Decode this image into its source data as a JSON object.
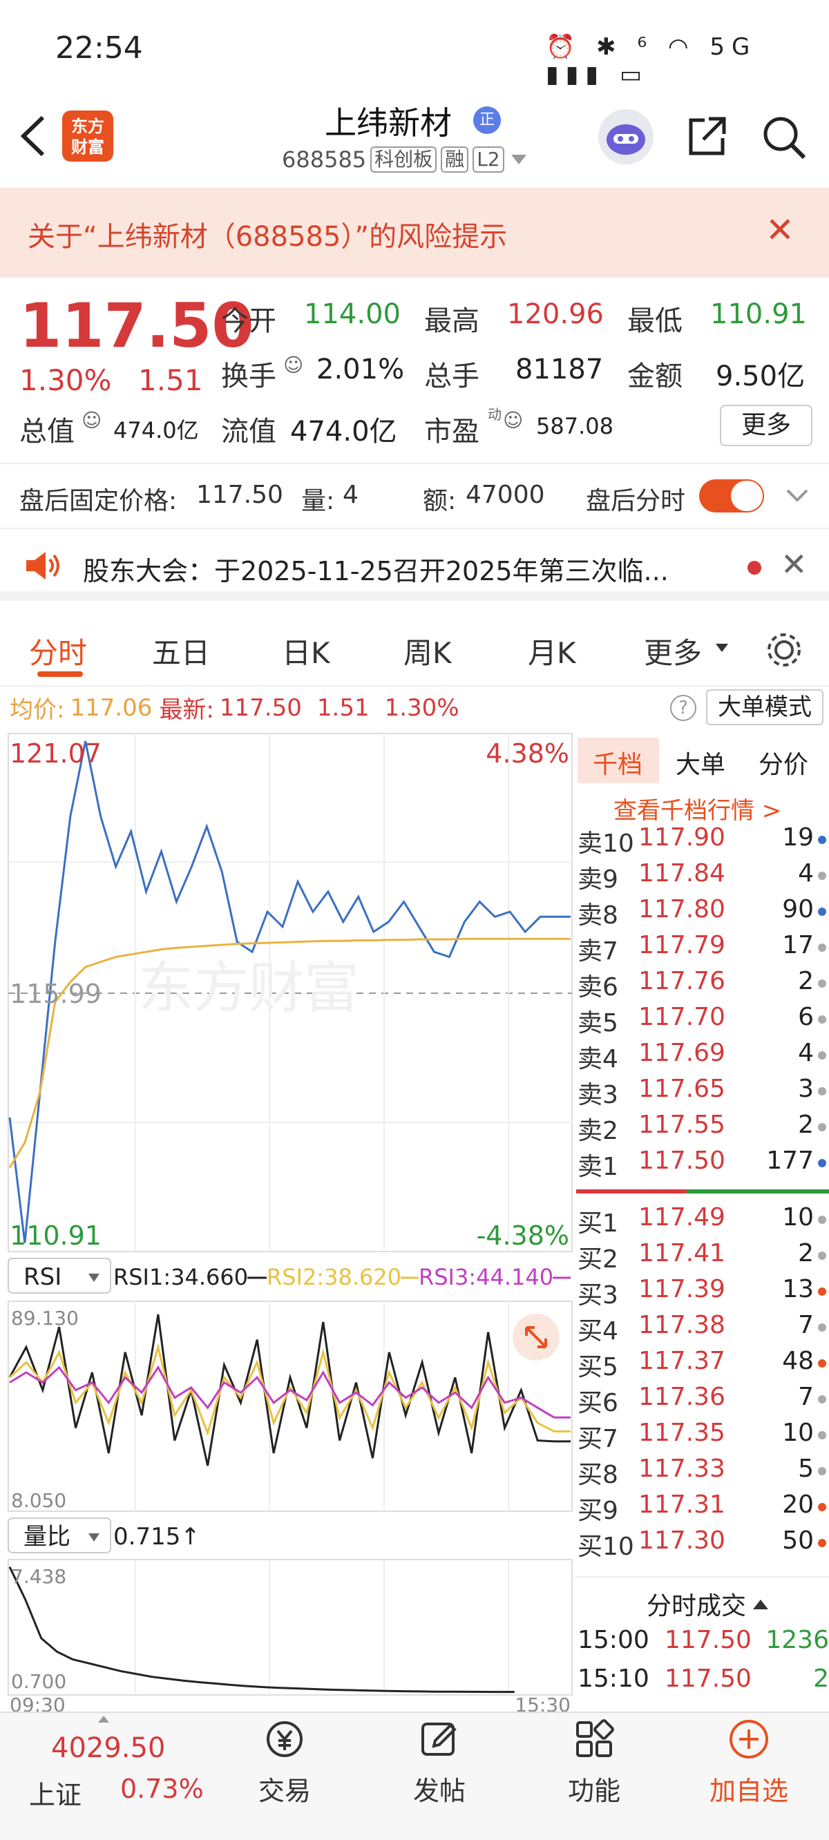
{
  "status_bar": {
    "time": "22:54",
    "icons": "⏰ ✱ ⁶ ◠ 5G ▮▮▮ ▭"
  },
  "header": {
    "logo_line1": "东方",
    "logo_line2": "财富",
    "stock_name": "上纬新材",
    "name_badge": "正",
    "stock_code": "688585",
    "tags": [
      "科创板",
      "融",
      "L2"
    ]
  },
  "risk_banner": {
    "text": "关于“上纬新材（688585）”的风险提示"
  },
  "quote": {
    "price": "117.50",
    "change_pct": "1.30%",
    "change_val": "1.51",
    "open_label": "今开",
    "open": "114.00",
    "high_label": "最高",
    "high": "120.96",
    "low_label": "最低",
    "low": "110.91",
    "turnover_label": "换手",
    "turnover": "2.01%",
    "volume_label": "总手",
    "volume": "81187",
    "amount_label": "金额",
    "amount": "9.50亿",
    "mktcap_label": "总值",
    "mktcap": "474.0亿",
    "float_label": "流值",
    "float": "474.0亿",
    "pe_label": "市盈",
    "pe_sup": "动",
    "pe": "587.08",
    "more": "更多"
  },
  "after_hours": {
    "price_label": "盘后固定价格:",
    "price": "117.50",
    "vol_label": "量:",
    "vol": "4",
    "amt_label": "额:",
    "amt": "47000",
    "timeshare_label": "盘后分时",
    "toggle_on": true
  },
  "notice": {
    "text": "股东大会：于2025-11-25召开2025年第三次临..."
  },
  "tabs": [
    "分时",
    "五日",
    "日K",
    "周K",
    "月K",
    "更多"
  ],
  "avg_row": {
    "avg_label": "均价:",
    "avg": "117.06",
    "latest_label": "最新:",
    "latest": "117.50",
    "chg": "1.51",
    "pct": "1.30%",
    "big_order_mode": "大单模式"
  },
  "chart_data": [
    {
      "type": "line",
      "title": "分时",
      "y_top_label": "121.07",
      "y_mid_label": "115.99",
      "y_bottom_label": "110.91",
      "pct_top_label": "4.38%",
      "pct_bottom_label": "-4.38%",
      "watermark": "东方财富",
      "ylim": [
        110.91,
        121.07
      ],
      "series": [
        {
          "name": "price",
          "color": "#3a6fc4",
          "values": [
            113.5,
            111.0,
            114.0,
            117.0,
            119.5,
            121.0,
            119.5,
            118.5,
            119.2,
            118.0,
            118.8,
            117.8,
            118.5,
            119.3,
            118.4,
            117.0,
            116.8,
            117.6,
            117.3,
            118.2,
            117.6,
            118.0,
            117.4,
            117.9,
            117.2,
            117.4,
            117.8,
            117.3,
            116.8,
            116.7,
            117.4,
            117.8,
            117.5,
            117.6,
            117.2,
            117.5,
            117.5,
            117.5
          ]
        },
        {
          "name": "avg",
          "color": "#e9b23f",
          "values": [
            112.5,
            113.0,
            114.0,
            115.8,
            116.2,
            116.5,
            116.6,
            116.7,
            116.75,
            116.8,
            116.85,
            116.88,
            116.9,
            116.92,
            116.94,
            116.96,
            116.97,
            116.98,
            116.99,
            117.0,
            117.01,
            117.02,
            117.02,
            117.03,
            117.03,
            117.04,
            117.04,
            117.05,
            117.05,
            117.05,
            117.06,
            117.06,
            117.06,
            117.06,
            117.06,
            117.06,
            117.06,
            117.06
          ]
        }
      ]
    },
    {
      "type": "line",
      "title": "RSI",
      "ylim": [
        8.05,
        89.13
      ],
      "y_top_label": "89.130",
      "y_bottom_label": "8.050",
      "series": [
        {
          "name": "RSI1",
          "label": "RSI1:34.660",
          "color": "#222222",
          "values": [
            60,
            72,
            55,
            80,
            40,
            62,
            30,
            70,
            45,
            85,
            35,
            55,
            25,
            65,
            50,
            75,
            30,
            60,
            40,
            82,
            35,
            58,
            28,
            70,
            45,
            66,
            38,
            60,
            30,
            78,
            40,
            55,
            35,
            34.66,
            34.66
          ]
        },
        {
          "name": "RSI2",
          "label": "RSI2:38.620",
          "color": "#e9c23f",
          "values": [
            60,
            66,
            58,
            70,
            50,
            58,
            42,
            62,
            50,
            72,
            45,
            55,
            38,
            60,
            52,
            66,
            42,
            56,
            46,
            70,
            44,
            55,
            40,
            62,
            48,
            58,
            44,
            56,
            40,
            66,
            46,
            52,
            42,
            38.62,
            38.62
          ]
        },
        {
          "name": "RSI3",
          "label": "RSI3:44.140",
          "color": "#c040c0",
          "values": [
            58,
            62,
            58,
            64,
            55,
            58,
            50,
            60,
            54,
            64,
            52,
            56,
            48,
            58,
            54,
            60,
            50,
            55,
            51,
            62,
            50,
            54,
            49,
            58,
            52,
            56,
            50,
            54,
            48,
            60,
            50,
            52,
            48,
            44.14,
            44.14
          ]
        }
      ]
    },
    {
      "type": "line",
      "title": "量比",
      "indicator_value": "0.715↑",
      "ylim": [
        0.7,
        7.438
      ],
      "y_top_label": "7.438",
      "y_bottom_label": "0.700",
      "x_start_label": "09:30",
      "x_end_label": "15:30",
      "series": [
        {
          "name": "量比",
          "color": "#222222",
          "values": [
            7.2,
            5.5,
            3.5,
            2.8,
            2.4,
            2.2,
            2.0,
            1.8,
            1.65,
            1.5,
            1.4,
            1.3,
            1.22,
            1.15,
            1.08,
            1.02,
            0.97,
            0.93,
            0.9,
            0.87,
            0.84,
            0.82,
            0.8,
            0.78,
            0.76,
            0.75,
            0.74,
            0.73,
            0.725,
            0.72,
            0.718,
            0.716,
            0.715
          ]
        }
      ]
    }
  ],
  "indicators": {
    "rsi_select": "RSI",
    "vr_select": "量比"
  },
  "order_book": {
    "tabs": [
      "千档",
      "大单",
      "分价"
    ],
    "view_link": "查看千档行情 >",
    "asks": [
      {
        "label": "卖10",
        "price": "117.90",
        "vol": "19",
        "dot": "#3a6fc4"
      },
      {
        "label": "卖9",
        "price": "117.84",
        "vol": "4",
        "dot": "#aaaaaa"
      },
      {
        "label": "卖8",
        "price": "117.80",
        "vol": "90",
        "dot": "#3a6fc4"
      },
      {
        "label": "卖7",
        "price": "117.79",
        "vol": "17",
        "dot": "#aaaaaa"
      },
      {
        "label": "卖6",
        "price": "117.76",
        "vol": "2",
        "dot": "#aaaaaa"
      },
      {
        "label": "卖5",
        "price": "117.70",
        "vol": "6",
        "dot": "#aaaaaa"
      },
      {
        "label": "卖4",
        "price": "117.69",
        "vol": "4",
        "dot": "#aaaaaa"
      },
      {
        "label": "卖3",
        "price": "117.65",
        "vol": "3",
        "dot": "#aaaaaa"
      },
      {
        "label": "卖2",
        "price": "117.55",
        "vol": "2",
        "dot": "#aaaaaa"
      },
      {
        "label": "卖1",
        "price": "117.50",
        "vol": "177",
        "dot": "#3a6fc4"
      }
    ],
    "bids": [
      {
        "label": "买1",
        "price": "117.49",
        "vol": "10",
        "dot": "#aaaaaa"
      },
      {
        "label": "买2",
        "price": "117.41",
        "vol": "2",
        "dot": "#aaaaaa"
      },
      {
        "label": "买3",
        "price": "117.39",
        "vol": "13",
        "dot": "#e9501f"
      },
      {
        "label": "买4",
        "price": "117.38",
        "vol": "7",
        "dot": "#aaaaaa"
      },
      {
        "label": "买5",
        "price": "117.37",
        "vol": "48",
        "dot": "#e9501f"
      },
      {
        "label": "买6",
        "price": "117.36",
        "vol": "7",
        "dot": "#aaaaaa"
      },
      {
        "label": "买7",
        "price": "117.35",
        "vol": "10",
        "dot": "#aaaaaa"
      },
      {
        "label": "买8",
        "price": "117.33",
        "vol": "5",
        "dot": "#aaaaaa"
      },
      {
        "label": "买9",
        "price": "117.31",
        "vol": "20",
        "dot": "#e9501f"
      },
      {
        "label": "买10",
        "price": "117.30",
        "vol": "50",
        "dot": "#e9501f"
      }
    ],
    "tick_title": "分时成交",
    "ticks": [
      {
        "time": "15:00",
        "price": "117.50",
        "vol": "1236"
      },
      {
        "time": "15:10",
        "price": "117.50",
        "vol": "2"
      }
    ]
  },
  "bottom_bar": {
    "index_value": "4029.50",
    "index_name": "上证",
    "index_pct": "0.73%",
    "items": [
      "交易",
      "发帖",
      "功能",
      "加自选"
    ]
  }
}
